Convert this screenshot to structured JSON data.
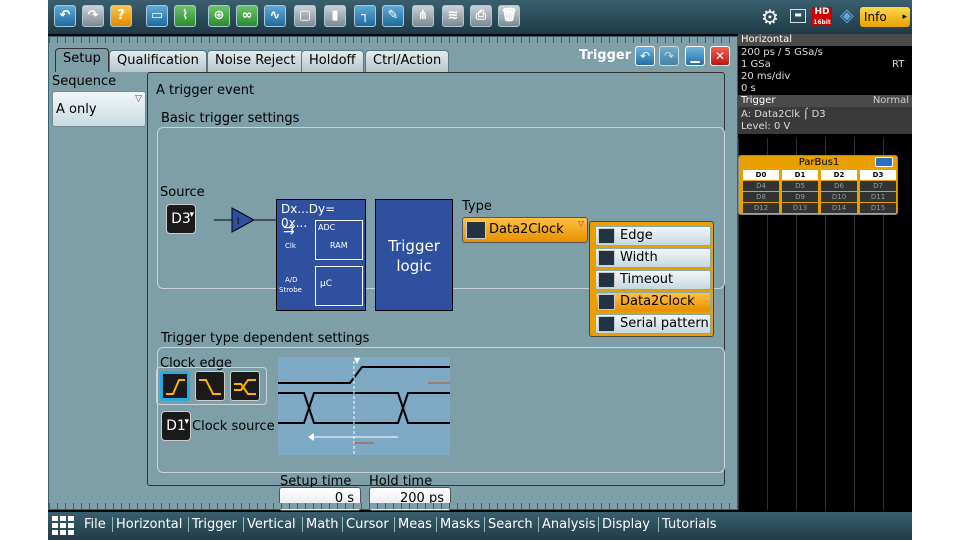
{
  "toolbar": {
    "icons": [
      "undo-icon",
      "redo-icon",
      "help-icon",
      "open-folder-icon",
      "signal-icon",
      "zoom-icon",
      "binoculars-icon",
      "waveform-icon",
      "screenshot-icon",
      "save-icon",
      "marker-icon",
      "measure-icon",
      "fft-icon",
      "protocol-icon",
      "print-icon",
      "delete-icon"
    ],
    "hd_label": "HD",
    "hd_sub": "16bit",
    "info_label": "Info"
  },
  "tabs": [
    "Setup",
    "Qualification",
    "Noise Reject",
    "Holdoff",
    "Ctrl/Action"
  ],
  "dialog_title": "Trigger",
  "sequence": {
    "label": "Sequence",
    "value": "A only"
  },
  "main": {
    "title": "A trigger event",
    "basic_title": "Basic trigger settings",
    "source_label": "Source",
    "source_value": "D3",
    "schematic": {
      "top": "Dx...Dy= 0x...",
      "adc": "ADC",
      "ram": "RAM",
      "clk": "Clk",
      "ad": "A/D",
      "strobe": "Strobe",
      "uc": "µC"
    },
    "logic_label": "Trigger logic",
    "type_label": "Type",
    "type_value": "Data2Clock",
    "type_menu": [
      "Edge",
      "Width",
      "Timeout",
      "Data2Clock",
      "Serial pattern"
    ],
    "dependent_title": "Trigger type dependent settings",
    "clock_edge_label": "Clock edge",
    "clock_source_value": "D1",
    "clock_source_label": "Clock source",
    "setup_time_label": "Setup time",
    "setup_time_value": "0 s",
    "hold_time_label": "Hold time",
    "hold_time_value": "200 ps"
  },
  "right": {
    "horizontal_head": "Horizontal",
    "hz_lines": [
      "200 ps / 5 GSa/s",
      "1 GSa",
      "20 ms/div",
      "0 s"
    ],
    "rt_label": "RT",
    "trigger_head": "Trigger",
    "trigger_mode": "Normal",
    "trigger_line1": "A:     Data2Clk",
    "trigger_channel": "D3",
    "trigger_level": "Level: 0 V",
    "parbus_title": "ParBus1",
    "parbus_cells": [
      "D0",
      "D1",
      "D2",
      "D3",
      "D4",
      "D5",
      "D6",
      "D7",
      "D8",
      "D9",
      "D10",
      "D11",
      "D12",
      "D13",
      "D14",
      "D15"
    ]
  },
  "menubar": [
    "File",
    "Horizontal",
    "Trigger",
    "Vertical",
    "Math",
    "Cursor",
    "Meas",
    "Masks",
    "Search",
    "Analysis",
    "Display",
    "Tutorials"
  ],
  "colors": {
    "accent": "#e89000",
    "dialog": "#7f9fa8",
    "schematic": "#2f4f9f",
    "selection": "#2aa8e0"
  }
}
